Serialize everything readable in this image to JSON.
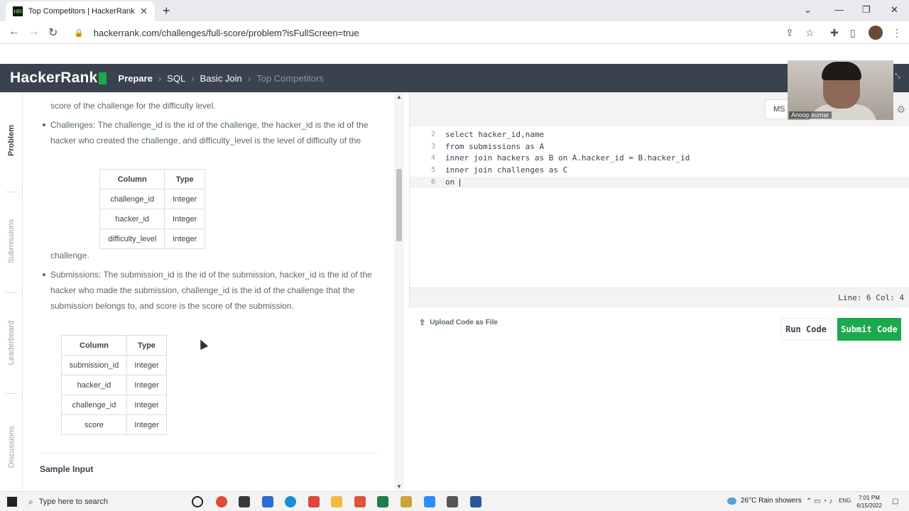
{
  "browser": {
    "tab_title": "Top Competitors | HackerRank",
    "favicon_text": "HR",
    "url": "hackerrank.com/challenges/full-score/problem?isFullScreen=true"
  },
  "header": {
    "logo": "HackerRank",
    "crumbs": [
      "Prepare",
      "SQL",
      "Basic Join",
      "Top Competitors"
    ]
  },
  "vertical_tabs": [
    "Problem",
    "Submissions",
    "Leaderboard",
    "Discussions"
  ],
  "problem": {
    "text_top": "score of the challenge for the difficulty level.",
    "challenges_line1": "Challenges: The challenge_id is the id of the challenge, the hacker_id is the id of the",
    "challenges_line2": "hacker who created the challenge, and difficulty_level is the level of difficulty of the",
    "challenges_line3": "challenge.",
    "challenges_table": {
      "headers": [
        "Column",
        "Type"
      ],
      "rows": [
        [
          "challenge_id",
          "Integer"
        ],
        [
          "hacker_id",
          "Integer"
        ],
        [
          "difficulty_level",
          "Integer"
        ]
      ]
    },
    "submissions_line1": "Submissions: The submission_id is the id of the submission, hacker_id is the id of the",
    "submissions_line2": "hacker who made the submission, challenge_id is the id of the challenge that the",
    "submissions_line3": "submission belongs to, and score is the score of the submission.",
    "submissions_table": {
      "headers": [
        "Column",
        "Type"
      ],
      "rows": [
        [
          "submission_id",
          "Integer"
        ],
        [
          "hacker_id",
          "Integer"
        ],
        [
          "challenge_id",
          "Integer"
        ],
        [
          "score",
          "Integer"
        ]
      ]
    },
    "sample_input": "Sample Input"
  },
  "editor": {
    "language": "MS S",
    "lines": [
      {
        "num": "2",
        "text": "select hacker_id,name"
      },
      {
        "num": "3",
        "text": "from submissions as A"
      },
      {
        "num": "4",
        "text": "inner join hackers as B on A.hacker_id = B.hacker_id"
      },
      {
        "num": "5",
        "text": "inner join challenges as C"
      },
      {
        "num": "6",
        "text": "on "
      }
    ],
    "status": "Line: 6 Col: 4"
  },
  "actions": {
    "upload": "Upload Code as File",
    "run": "Run Code",
    "submit": "Submit Code"
  },
  "webcam": {
    "name": "Anoop kumar"
  },
  "taskbar": {
    "search_placeholder": "Type here to search",
    "weather": "26°C  Rain showers",
    "lang": "ENG",
    "time": "7:01 PM",
    "date": "6/15/2022"
  },
  "colors": {
    "header_bg": "#39424e",
    "brand_green": "#1ba94c"
  }
}
